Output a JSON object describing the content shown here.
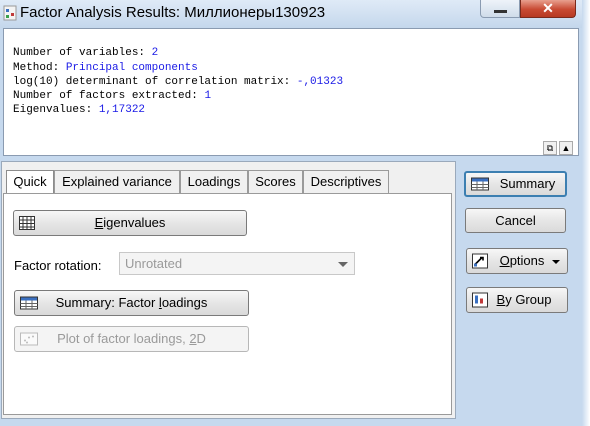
{
  "window": {
    "title": "Factor Analysis Results: Миллионеры130923",
    "close_glyph": "✕"
  },
  "output": {
    "lines": [
      {
        "label": "Number of variables: ",
        "value": "2"
      },
      {
        "label": "Method: ",
        "value": "Principal components"
      },
      {
        "label": "log(10) determinant of correlation matrix: ",
        "value": "-,01323"
      },
      {
        "label": "Number of factors extracted: ",
        "value": "1"
      },
      {
        "label": "Eigenvalues: ",
        "value": "1,17322"
      }
    ],
    "value_color": "#1a1ae6"
  },
  "tabs": [
    {
      "label": "Quick"
    },
    {
      "label": "Explained variance"
    },
    {
      "label": "Loadings"
    },
    {
      "label": "Scores"
    },
    {
      "label": "Descriptives"
    }
  ],
  "quick": {
    "eigen_prefix": "",
    "eigen_ul": "E",
    "eigen_rest": "igenvalues",
    "rotation_label": "Factor rotation:",
    "rotation_value": "Unrotated",
    "summary_loadings_prefix": "Summary: Factor ",
    "summary_loadings_ul": "l",
    "summary_loadings_rest": "oadings",
    "plot_prefix": "Plot of factor loadings, ",
    "plot_ul": "2",
    "plot_rest": "D"
  },
  "side": {
    "summary": "Summary",
    "cancel": "Cancel",
    "options_ul": "O",
    "options_rest": "ptions",
    "bygroup_ul": "B",
    "bygroup_rest": "y Group"
  },
  "colors": {
    "accent": "#3c7fb1",
    "window_bg": "#c6d9ee"
  }
}
